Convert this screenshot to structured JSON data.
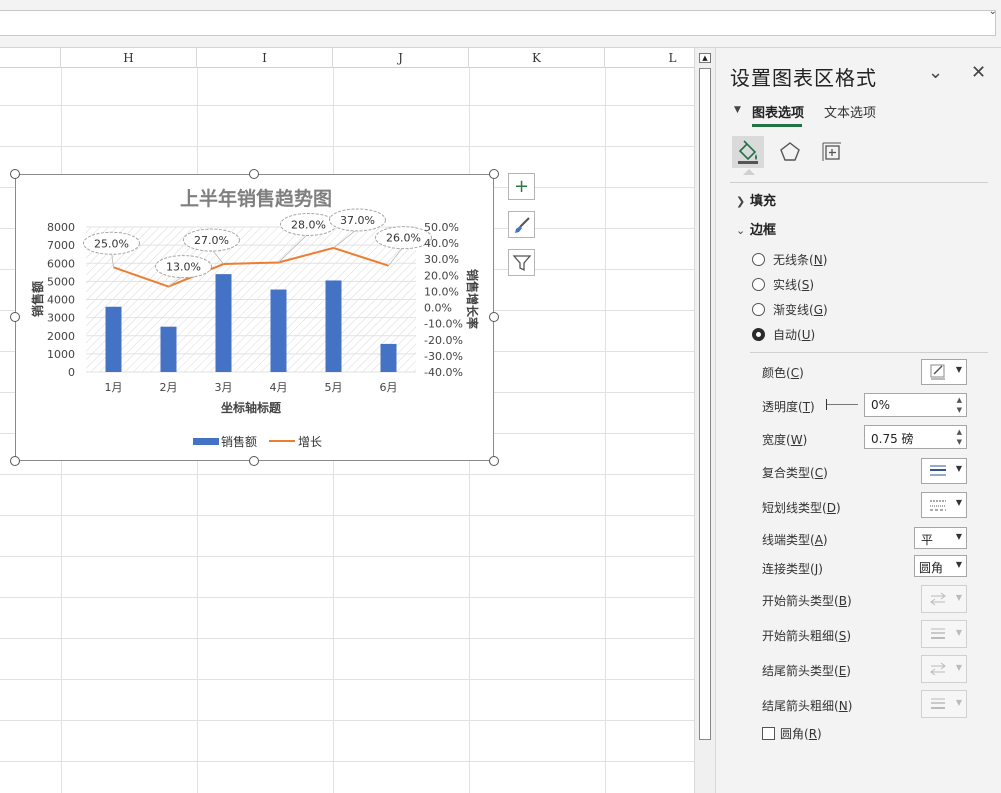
{
  "sheet": {
    "columns": [
      "H",
      "I",
      "J",
      "K",
      "L"
    ]
  },
  "chart_data": {
    "type": "bar",
    "title": "上半年销售趋势图",
    "categories": [
      "1月",
      "2月",
      "3月",
      "4月",
      "5月",
      "6月"
    ],
    "xlabel": "坐标轴标题",
    "ylabel": "销售额",
    "y2label": "销售增长率",
    "ylim": [
      0,
      8000
    ],
    "y2lim": [
      -40,
      50
    ],
    "y_ticks": [
      "0",
      "1000",
      "2000",
      "3000",
      "4000",
      "5000",
      "6000",
      "7000",
      "8000"
    ],
    "y2_ticks": [
      "-40.0%",
      "-30.0%",
      "-20.0%",
      "-10.0%",
      "0.0%",
      "10.0%",
      "20.0%",
      "30.0%",
      "40.0%",
      "50.0%"
    ],
    "series": [
      {
        "name": "销售额",
        "type": "bar",
        "color": "#4472c4",
        "values": [
          3600,
          2500,
          5400,
          4550,
          5050,
          1550
        ]
      },
      {
        "name": "增长",
        "type": "line",
        "axis": "secondary",
        "color": "#ed7d31",
        "values": [
          25.0,
          13.0,
          27.0,
          28.0,
          37.0,
          26.0
        ]
      }
    ],
    "data_labels": [
      "25.0%",
      "13.0%",
      "27.0%",
      "28.0%",
      "37.0%",
      "26.0%"
    ],
    "legend": "bottom",
    "grid": true
  },
  "chart_buttons": {
    "add": "+",
    "style": "brush-icon",
    "filter": "filter-icon"
  },
  "pane": {
    "title": "设置图表区格式",
    "tabs": [
      "图表选项",
      "文本选项"
    ],
    "sections": {
      "fill": "填充",
      "border": "边框"
    },
    "border_options": [
      "无线条(N)",
      "实线(S)",
      "渐变线(G)",
      "自动(U)"
    ],
    "border_keys": [
      "N",
      "S",
      "G",
      "U"
    ],
    "border_names": [
      "无线条",
      "实线",
      "渐变线",
      "自动"
    ],
    "selected_border": "自动(U)",
    "props": {
      "color_label": "颜色",
      "color_key": "C",
      "transparency_label": "透明度",
      "transparency_key": "T",
      "transparency_value": "0%",
      "width_label": "宽度",
      "width_key": "W",
      "width_value": "0.75 磅",
      "compound_label": "复合类型",
      "compound_key": "C",
      "dash_label": "短划线类型",
      "dash_key": "D",
      "cap_label": "线端类型",
      "cap_key": "A",
      "cap_value": "平",
      "join_label": "连接类型",
      "join_key": "J",
      "join_value": "圆角",
      "begin_type_label": "开始箭头类型",
      "begin_type_key": "B",
      "begin_size_label": "开始箭头粗细",
      "begin_size_key": "S",
      "end_type_label": "结尾箭头类型",
      "end_type_key": "E",
      "end_size_label": "结尾箭头粗细",
      "end_size_key": "N",
      "rounded_label": "圆角",
      "rounded_key": "R"
    }
  }
}
